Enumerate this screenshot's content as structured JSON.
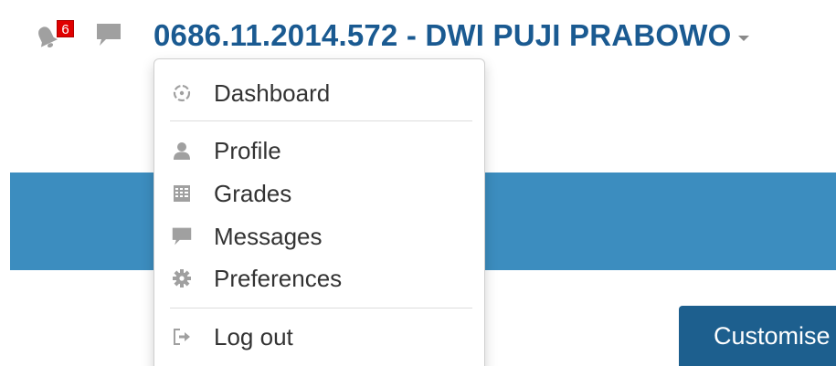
{
  "header": {
    "notifications": {
      "icon": "bell-icon",
      "count": "6"
    },
    "messages_icon": "message-icon",
    "user_name": "0686.11.2014.572 - DWI PUJI PRABOWO",
    "caret_icon": "caret-down-icon"
  },
  "user_menu": {
    "items": [
      {
        "label": "Dashboard",
        "icon": "dashboard-icon"
      },
      {
        "label": "Profile",
        "icon": "user-icon"
      },
      {
        "label": "Grades",
        "icon": "grades-icon"
      },
      {
        "label": "Messages",
        "icon": "message-icon"
      },
      {
        "label": "Preferences",
        "icon": "gear-icon"
      },
      {
        "label": "Log out",
        "icon": "logout-icon"
      }
    ]
  },
  "actions": {
    "customise_label": "Customise"
  },
  "colors": {
    "user_name": "#1a5a91",
    "banner": "#3c8dbf",
    "button": "#1d5f8e",
    "badge": "#e00000",
    "icon_gray": "#a0a0a0"
  }
}
